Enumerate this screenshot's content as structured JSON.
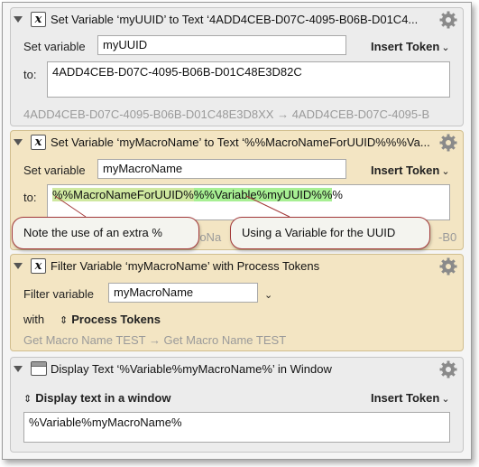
{
  "actions": [
    {
      "title": "Set Variable ‘myUUID’ to Text ‘4ADD4CEB-D07C-4095-B06B-D01C4...",
      "set_variable_label": "Set variable",
      "variable_value": "myUUID",
      "insert_token_label": "Insert Token",
      "to_label": "to:",
      "text_value": "4ADD4CEB-D07C-4095-B06B-D01C48E3D82C",
      "result_text": "4ADD4CEB-D07C-4095-B06B-D01C48E3D8XX → 4ADD4CEB-D07C-4095-B"
    },
    {
      "title": "Set Variable ‘myMacroName’ to Text ‘%%MacroNameForUUID%%%Va...",
      "set_variable_label": "Set variable",
      "variable_value": "myMacroName",
      "insert_token_label": "Insert Token",
      "to_label": "to:",
      "text_part1": "%%MacroNameForUUID%",
      "text_part2": "%%Variable%myUUID%%",
      "text_part3": "%",
      "result_fragment_left": "roNa",
      "result_fragment_right": "-B0"
    },
    {
      "title": "Filter Variable ‘myMacroName’ with Process Tokens",
      "filter_variable_label": "Filter variable",
      "variable_value": "myMacroName",
      "with_label": "with",
      "process_tokens_label": "Process Tokens",
      "result_text": "Get Macro Name TEST → Get Macro Name TEST"
    },
    {
      "title": "Display Text ‘%Variable%myMacroName%’ in Window",
      "display_mode_label": "Display text in a window",
      "insert_token_label": "Insert Token",
      "text_value": "%Variable%myMacroName%"
    }
  ],
  "callouts": {
    "left": "Note the use of an extra %",
    "right": "Using a Variable for the UUID"
  },
  "colors": {
    "accent_callout_border": "#a33a3a",
    "highlight_green": "#a7ef93",
    "highlight_yellow_green": "#cfe8a0",
    "tan_action_bg": "#f3e5c3"
  }
}
